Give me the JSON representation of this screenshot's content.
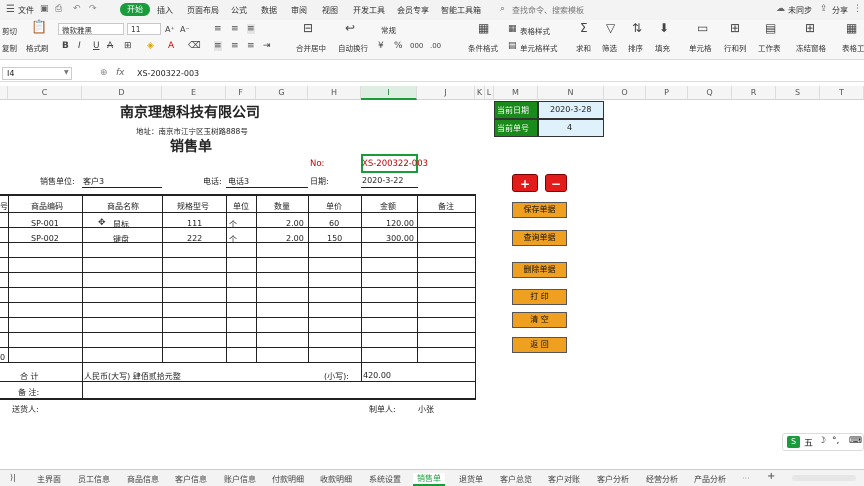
{
  "menu": {
    "items": [
      "文件",
      "开始",
      "插入",
      "页面布局",
      "公式",
      "数据",
      "审阅",
      "视图",
      "开发工具",
      "会员专享",
      "智能工具箱"
    ],
    "active": "开始",
    "search": "查找命令、搜索模板",
    "sync": "未同步",
    "share": "分享"
  },
  "ribbon": {
    "cut": "剪切",
    "copy": "复制",
    "format_painter": "格式刷",
    "paste": "粘贴",
    "font": "微软雅黑",
    "size": "11",
    "merge": "合并居中",
    "wrap": "自动换行",
    "number_format": "常规",
    "cond_format": "条件格式",
    "table_style": "表格样式",
    "cell_style": "单元格样式",
    "sum": "求和",
    "filter": "筛选",
    "sort": "排序",
    "fill": "填充",
    "cell": "单元格",
    "rowcol": "行和列",
    "sheet": "工作表",
    "freeze": "冻结窗格",
    "table_tools": "表格工",
    "bold": "B",
    "italic": "I",
    "underline": "U",
    "strike": "A"
  },
  "formula": {
    "name_box": "I4",
    "fx": "fx",
    "content": "XS-200322-003"
  },
  "columns": [
    "C",
    "D",
    "E",
    "F",
    "G",
    "H",
    "I",
    "J",
    "K",
    "L",
    "M",
    "N",
    "O",
    "P",
    "Q",
    "R",
    "S",
    "T"
  ],
  "form": {
    "company": "南京理想科技有限公司",
    "address": "地址：南京市江宁区玉树路888号",
    "title": "销售单",
    "no_label": "No:",
    "no_value": "XS-200322-003",
    "unit_label": "销售单位:",
    "unit_value": "客户3",
    "phone_label": "电话:",
    "phone_value": "电话3",
    "date_label": "日期:",
    "date_value": "2020-3-22",
    "headers": [
      "号",
      "商品编码",
      "商品名称",
      "规格型号",
      "单位",
      "数量",
      "单价",
      "金额",
      "备注"
    ],
    "rows": [
      {
        "code": "SP-001",
        "name": "鼠标",
        "spec": "111",
        "unit": "个",
        "qty": "2.00",
        "price": "60",
        "amount": "120.00"
      },
      {
        "code": "SP-002",
        "name": "键盘",
        "spec": "222",
        "unit": "个",
        "qty": "2.00",
        "price": "150",
        "amount": "300.00"
      }
    ],
    "total_label": "合  计",
    "total_words": "人民币(大写) 肆佰贰拾元整",
    "small_label": "(小写):",
    "small_value": "420.00",
    "remark_label": "备  注:",
    "sender_label": "送货人:",
    "maker_label": "制单人:",
    "maker_value": "小张",
    "last_row_num": "0"
  },
  "side": {
    "cur_date_label": "当前日期",
    "cur_date_value": "2020-3-28",
    "cur_no_label": "当前单号",
    "cur_no_value": "4"
  },
  "buttons": {
    "plus": "+",
    "minus": "−",
    "save": "保存单据",
    "query": "查询单据",
    "delete": "删除单据",
    "print": "打    印",
    "clear": "清    空",
    "back": "返    回"
  },
  "tabs": [
    "主界面",
    "员工信息",
    "商品信息",
    "客户信息",
    "账户信息",
    "付款明细",
    "收款明细",
    "系统设置",
    "销售单",
    "退货单",
    "客户总览",
    "客户对账",
    "客户分析",
    "经营分析",
    "产品分析"
  ],
  "active_tab": "销售单",
  "colors": {
    "accent": "#1a9c3c",
    "button": "#f0a020",
    "plus": "#e21b1b",
    "side_label": "#1a8a1a",
    "side_value": "#dff2fb",
    "red_text": "#c00000"
  }
}
